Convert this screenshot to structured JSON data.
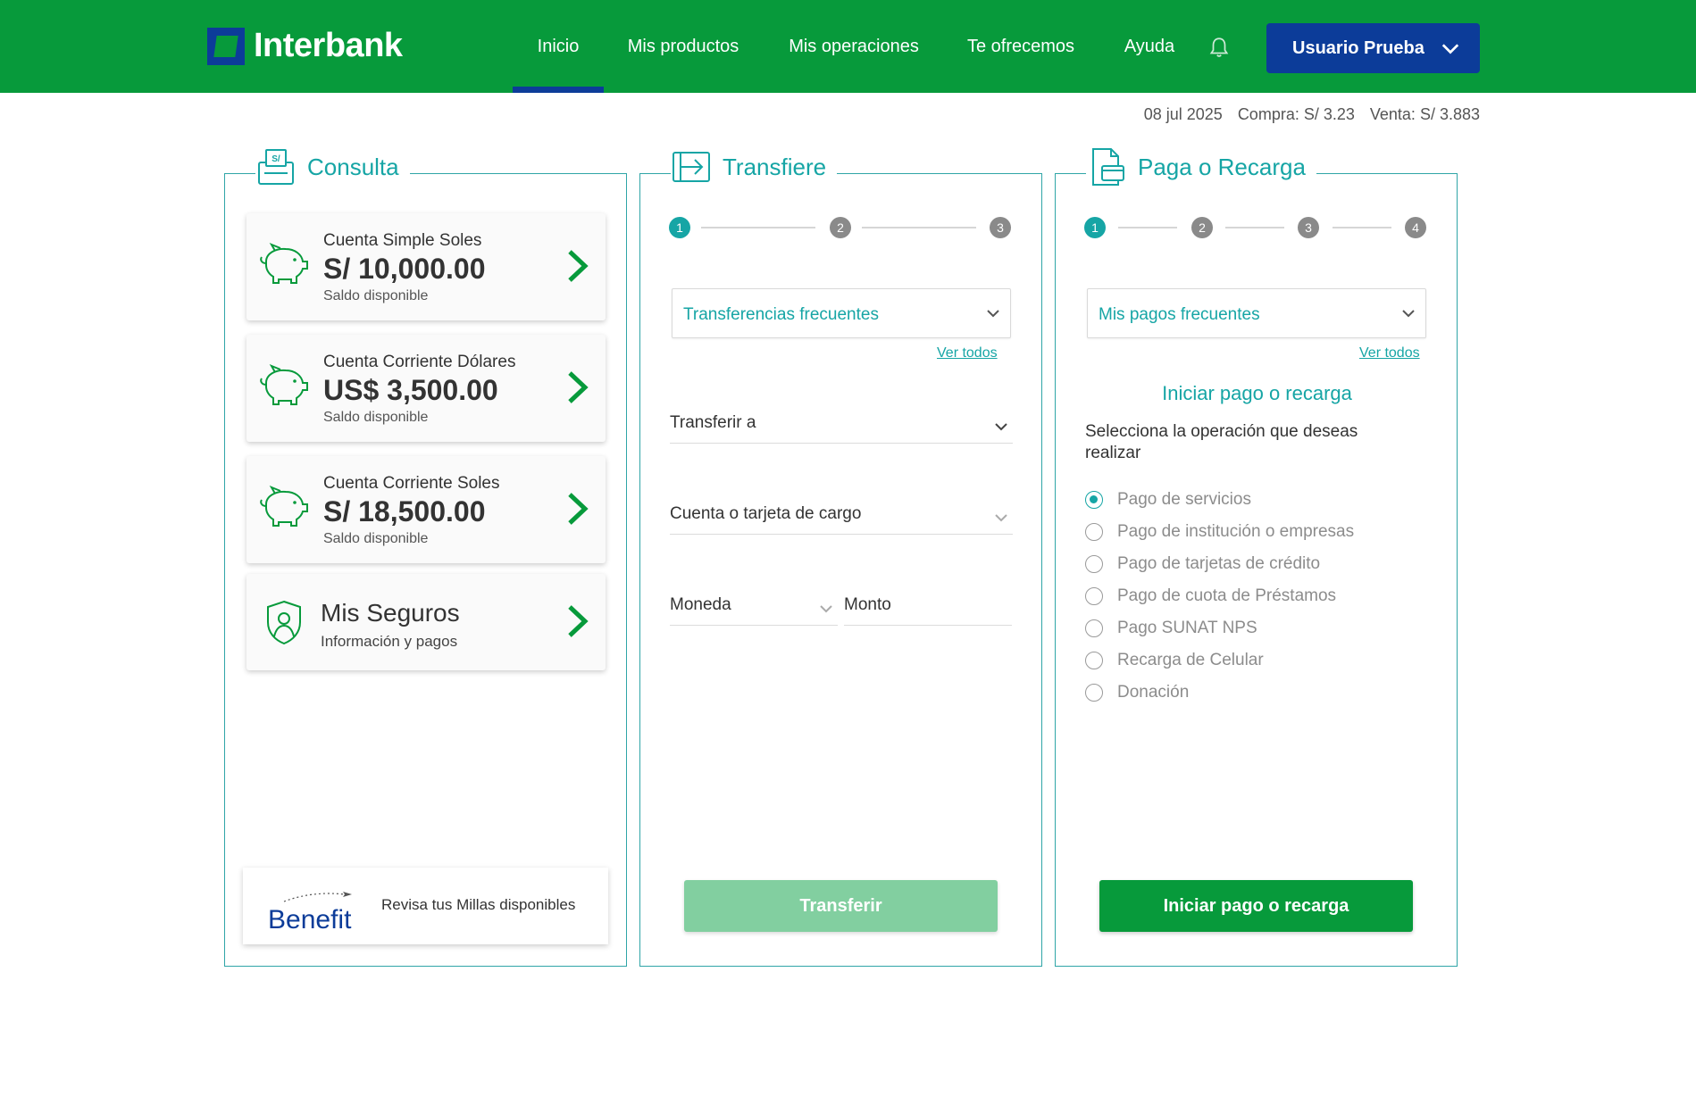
{
  "brand": {
    "name": "Interbank",
    "colors": {
      "primary": "#079a3b",
      "secondary": "#0c3c99",
      "accent": "#16a5a5"
    }
  },
  "nav": {
    "items": [
      {
        "label": "Inicio",
        "active": true
      },
      {
        "label": "Mis productos",
        "active": false
      },
      {
        "label": "Mis operaciones",
        "active": false
      },
      {
        "label": "Te ofrecemos",
        "active": false
      },
      {
        "label": "Ayuda",
        "active": false
      }
    ],
    "bell_icon": "bell-icon",
    "user_label": "Usuario Prueba"
  },
  "exchange": {
    "date": "08 jul 2025",
    "buy": "Compra: S/ 3.23",
    "sell": "Venta: S/ 3.883"
  },
  "consulta": {
    "title": "Consulta",
    "accounts": [
      {
        "name": "Cuenta Simple Soles",
        "balance": "S/ 10,000.00",
        "subtitle": "Saldo disponible"
      },
      {
        "name": "Cuenta Corriente Dólares",
        "balance": "US$ 3,500.00",
        "subtitle": "Saldo disponible"
      },
      {
        "name": "Cuenta Corriente Soles",
        "balance": "S/ 18,500.00",
        "subtitle": "Saldo disponible"
      }
    ],
    "insurance": {
      "name": "Mis Seguros",
      "subtitle": "Información y pagos"
    },
    "benefit": {
      "logo_text": "Benefit",
      "text": "Revisa tus Millas disponibles"
    }
  },
  "transfiere": {
    "title": "Transfiere",
    "steps": [
      "1",
      "2",
      "3"
    ],
    "current_step": 1,
    "frequent_label": "Transferencias frecuentes",
    "see_all": "Ver todos",
    "field_to": "Transferir a",
    "field_account": "Cuenta o tarjeta de cargo",
    "field_currency": "Moneda",
    "field_amount": "Monto",
    "button": "Transferir"
  },
  "pago": {
    "title": "Paga o Recarga",
    "steps": [
      "1",
      "2",
      "3",
      "4"
    ],
    "current_step": 1,
    "frequent_label": "Mis pagos frecuentes",
    "see_all": "Ver todos",
    "heading": "Iniciar pago o recarga",
    "description": "Selecciona la operación que deseas realizar",
    "options": [
      {
        "label": "Pago de servicios",
        "selected": true
      },
      {
        "label": "Pago de institución o empresas",
        "selected": false
      },
      {
        "label": "Pago de tarjetas de crédito",
        "selected": false
      },
      {
        "label": "Pago de cuota de Préstamos",
        "selected": false
      },
      {
        "label": "Pago SUNAT NPS",
        "selected": false
      },
      {
        "label": "Recarga de Celular",
        "selected": false
      },
      {
        "label": "Donación",
        "selected": false
      }
    ],
    "button": "Iniciar pago o recarga"
  }
}
